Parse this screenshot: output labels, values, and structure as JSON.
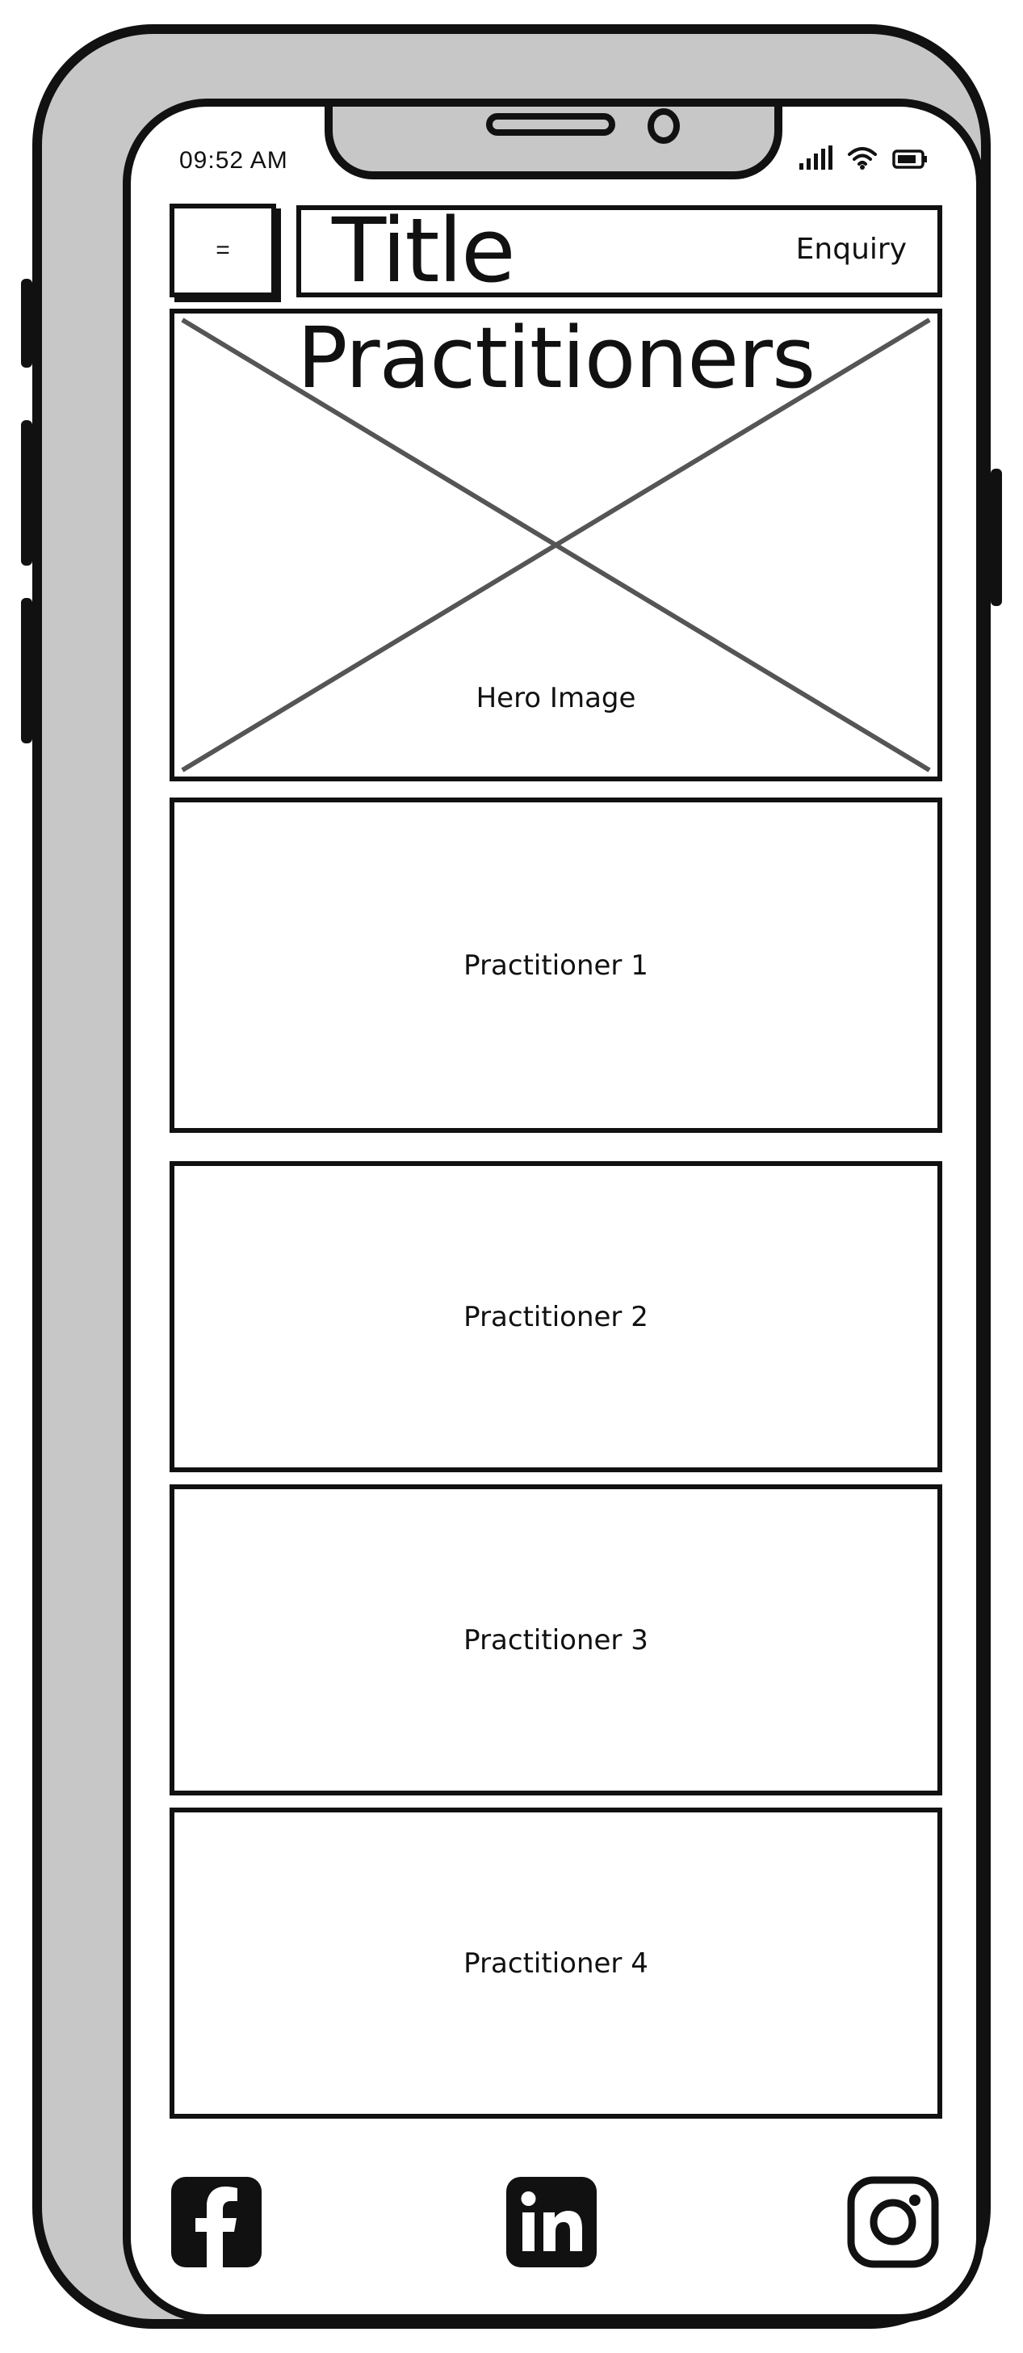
{
  "status_bar": {
    "time": "09:52 AM",
    "icons": [
      "signal-icon",
      "wifi-icon",
      "battery-icon"
    ]
  },
  "header": {
    "menu_label": "=",
    "title": "Title",
    "enquiry_label": "Enquiry"
  },
  "hero": {
    "heading": "Practitioners",
    "image_caption": "Hero Image"
  },
  "practitioners": [
    {
      "label": "Practitioner 1"
    },
    {
      "label": "Practitioner 2"
    },
    {
      "label": "Practitioner 3"
    },
    {
      "label": "Practitioner 4"
    }
  ],
  "footer": {
    "social_icons": [
      "facebook-icon",
      "linkedin-icon",
      "instagram-icon"
    ]
  },
  "colors": {
    "frame": "#c7c7c7",
    "stroke": "#111111",
    "screen": "#ffffff"
  }
}
